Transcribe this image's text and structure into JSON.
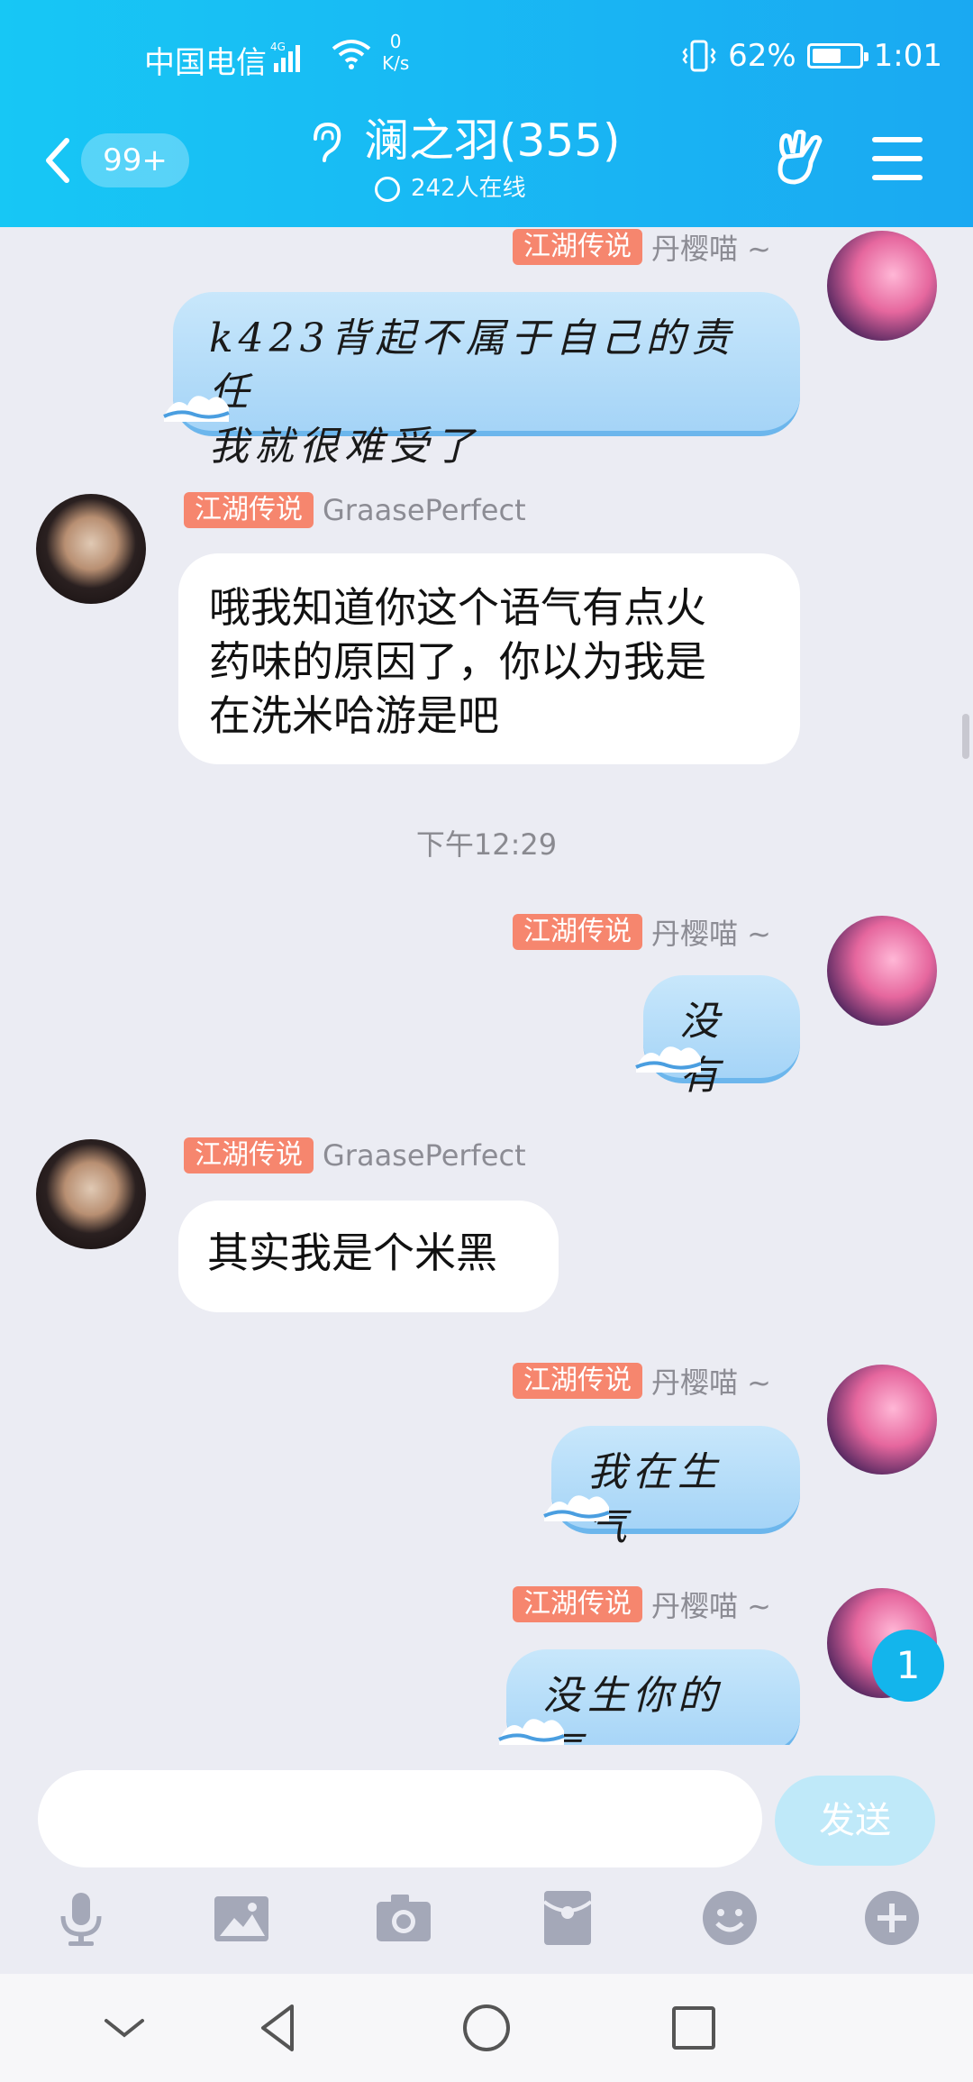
{
  "status_bar": {
    "carrier": "中国电信",
    "network": "4G",
    "net_speed_value": "0",
    "net_speed_unit": "K/s",
    "battery_percent": "62%",
    "battery_level": 0.62,
    "time": "1:01"
  },
  "header": {
    "unread_badge": "99+",
    "title": "澜之羽(355)",
    "online_count": "242人在线"
  },
  "messages": [
    {
      "side": "right",
      "tag": "江湖传说",
      "name": "丹樱喵 ~",
      "text": "k423背起不属于自己的责任\n我就很难受了"
    },
    {
      "side": "left",
      "tag": "江湖传说",
      "name": "GraasePerfect",
      "text": "哦我知道你这个语气有点火\n药味的原因了，你以为我是\n在洗米哈游是吧"
    },
    {
      "timestamp": "下午12:29"
    },
    {
      "side": "right",
      "tag": "江湖传说",
      "name": "丹樱喵 ~",
      "text": "没有"
    },
    {
      "side": "left",
      "tag": "江湖传说",
      "name": "GraasePerfect",
      "text": "其实我是个米黑"
    },
    {
      "side": "right",
      "tag": "江湖传说",
      "name": "丹樱喵 ~",
      "text": "我在生气"
    },
    {
      "side": "right",
      "tag": "江湖传说",
      "name": "丹樱喵 ~",
      "text": "没生你的气"
    }
  ],
  "new_message_count": "1",
  "input": {
    "value": "",
    "send_label": "发送"
  },
  "toolbar": [
    "mic-icon",
    "image-icon",
    "camera-icon",
    "red-packet-icon",
    "emoji-icon",
    "plus-icon"
  ],
  "colors": {
    "header_start": "#17c7f5",
    "header_end": "#1aa9f2",
    "tag": "#f6866e",
    "bubble_blue": "#a5d4f7"
  }
}
